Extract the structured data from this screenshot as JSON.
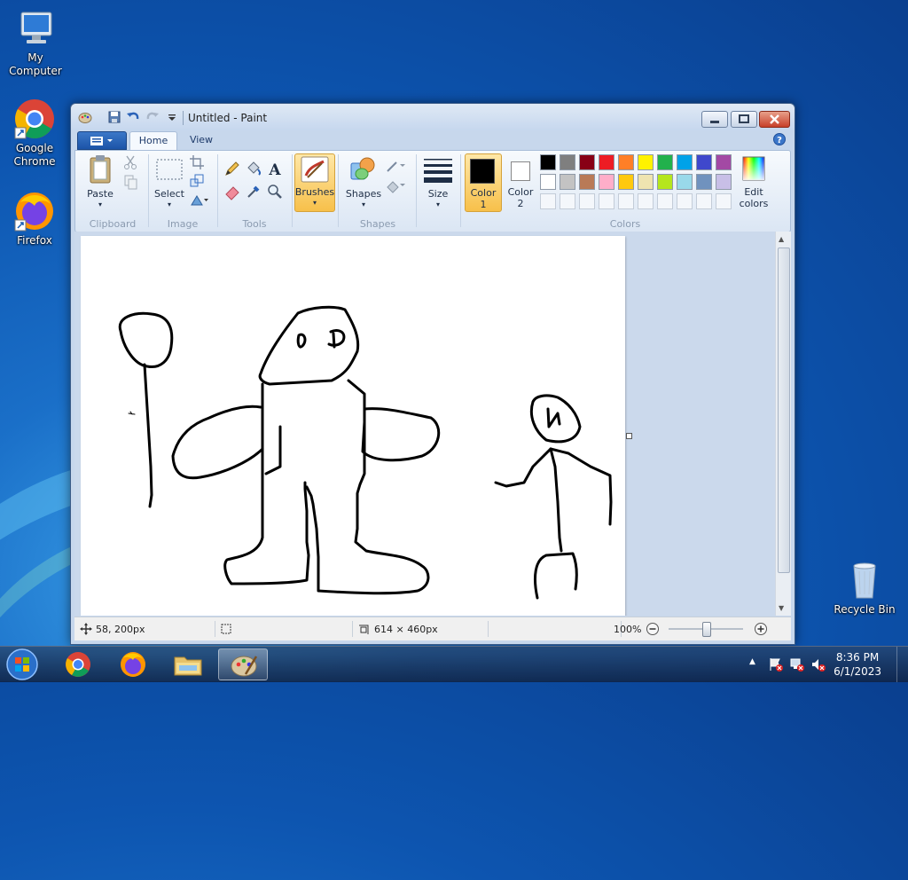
{
  "desktop": {
    "icons": [
      {
        "label": "My Computer",
        "icon": "computer-icon"
      },
      {
        "label": "Google Chrome",
        "icon": "chrome-icon"
      },
      {
        "label": "Firefox",
        "icon": "firefox-icon"
      },
      {
        "label": "Recycle Bin",
        "icon": "recycle-bin-icon"
      }
    ]
  },
  "window": {
    "title": "Untitled - Paint",
    "tabs": [
      {
        "label": "Home",
        "active": true
      },
      {
        "label": "View",
        "active": false
      }
    ],
    "ribbon": {
      "clipboard": {
        "paste_label": "Paste",
        "group_label": "Clipboard"
      },
      "image": {
        "select_label": "Select",
        "group_label": "Image"
      },
      "tools": {
        "group_label": "Tools"
      },
      "brushes": {
        "label": "Brushes"
      },
      "shapes": {
        "label": "Shapes",
        "group_label": "Shapes"
      },
      "size": {
        "label": "Size"
      },
      "color1": {
        "label_line1": "Color",
        "label_line2": "1",
        "value": "#000000"
      },
      "color2": {
        "label_line1": "Color",
        "label_line2": "2",
        "value": "#ffffff"
      },
      "colors": {
        "group_label": "Colors"
      },
      "edit_colors": {
        "label_line1": "Edit",
        "label_line2": "colors"
      },
      "palette_row1": [
        "#000000",
        "#7f7f7f",
        "#880015",
        "#ed1c24",
        "#ff7f27",
        "#fff200",
        "#22b14c",
        "#00a2e8",
        "#3f48cc",
        "#a349a4"
      ],
      "palette_row2": [
        "#ffffff",
        "#c3c3c3",
        "#b97a57",
        "#ffaec9",
        "#ffc90e",
        "#efe4b0",
        "#b5e61d",
        "#99d9ea",
        "#7092be",
        "#c8bfe7"
      ]
    },
    "status": {
      "cursor_position": "58, 200px",
      "image_size": "614 × 460px",
      "zoom": "100%"
    }
  },
  "taskbar": {
    "time": "8:36 PM",
    "date": "6/1/2023"
  }
}
